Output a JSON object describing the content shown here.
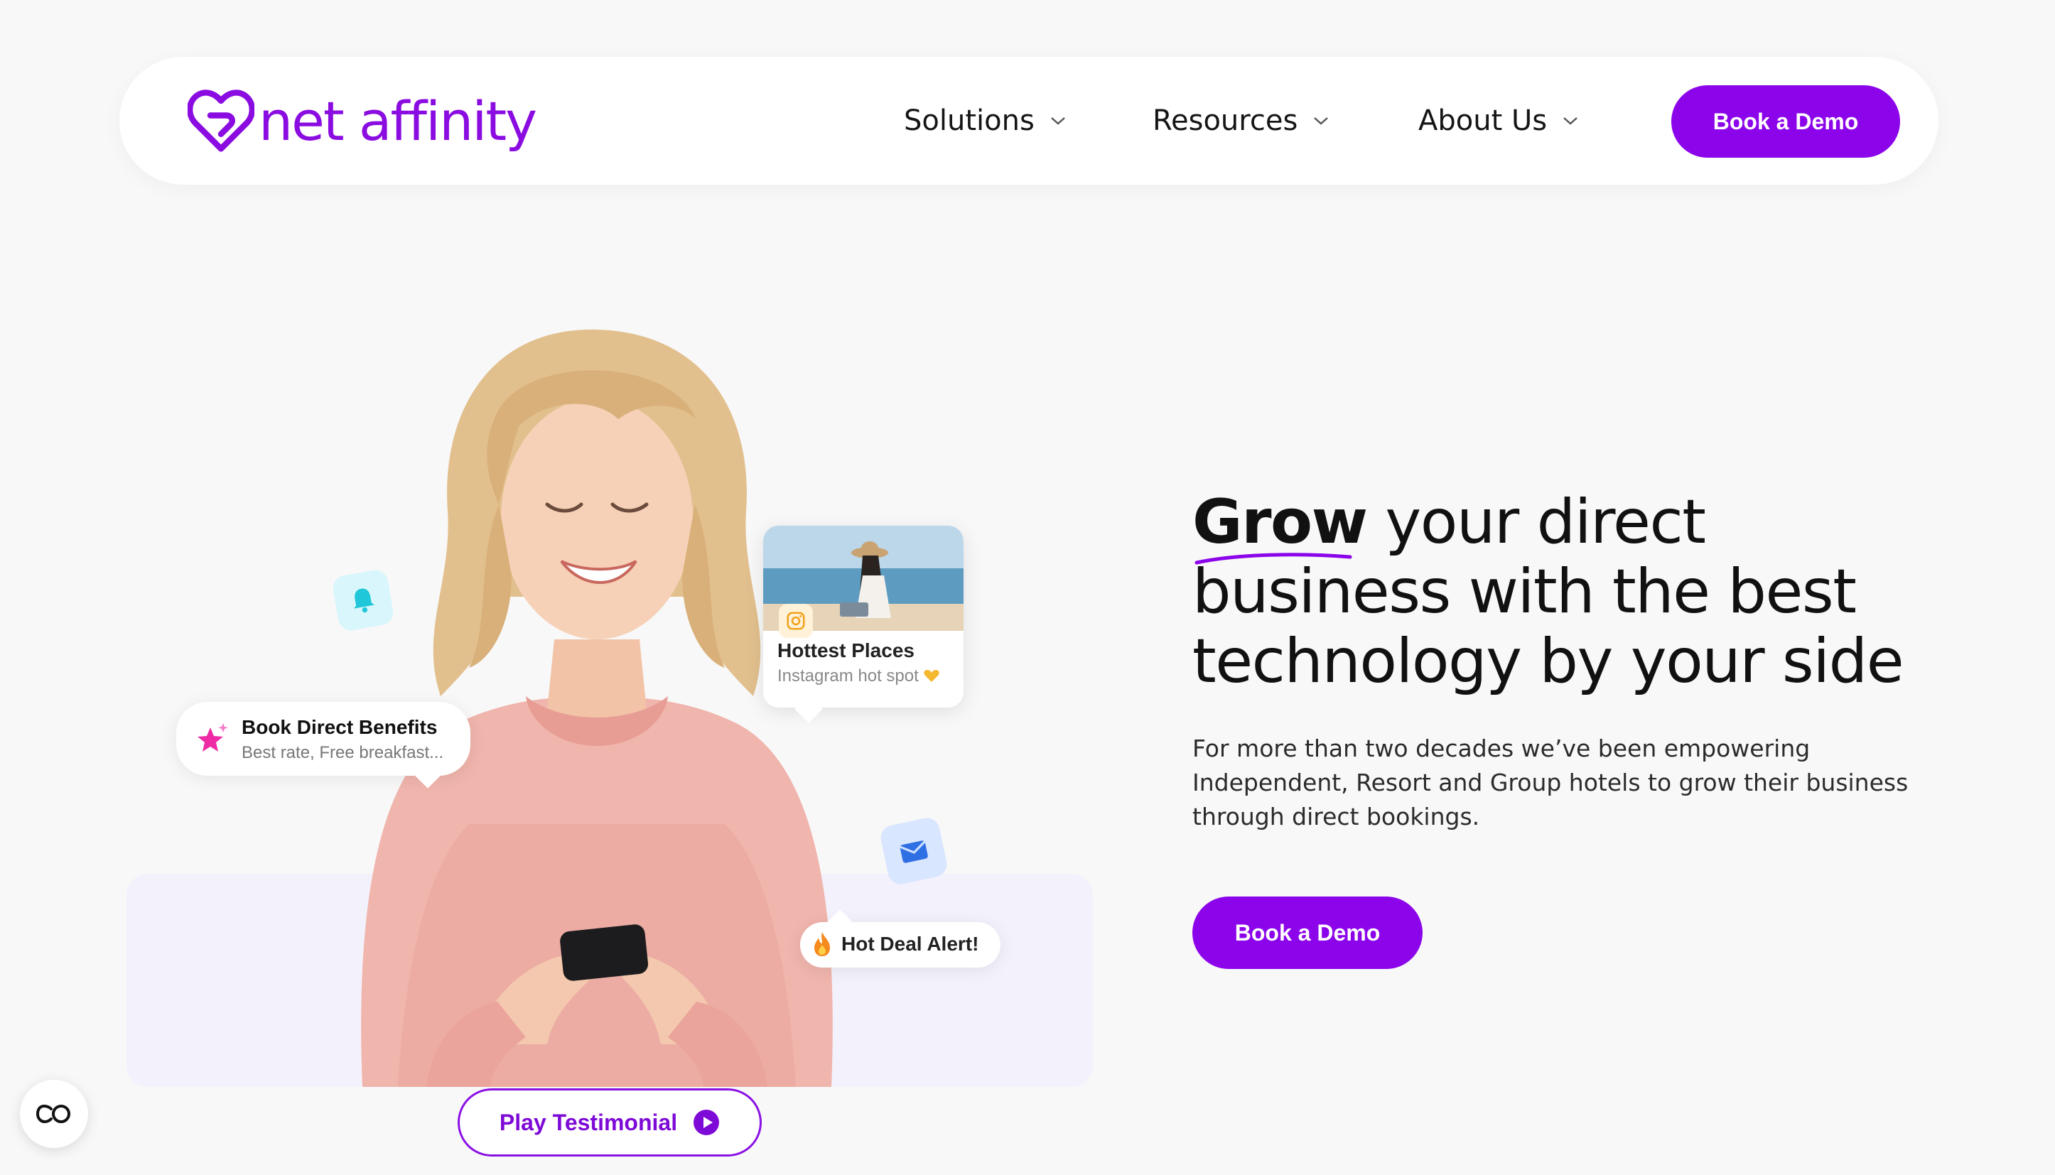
{
  "header": {
    "logo_text": "net affinity",
    "nav": [
      {
        "label": "Solutions"
      },
      {
        "label": "Resources"
      },
      {
        "label": "About Us"
      }
    ],
    "cta_label": "Book a Demo"
  },
  "hero": {
    "headline_bold": "Grow",
    "headline_line1_rest": "your direct",
    "headline_line2": "business with the best",
    "headline_line3": "technology by your side",
    "description": "For more than two decades we’ve been empowering Independent, Resort and Group hotels to grow their business through direct bookings.",
    "cta_label": "Book a Demo",
    "testimonial_label": "Play Testimonial"
  },
  "floating": {
    "book_direct": {
      "title": "Book Direct Benefits",
      "subtitle": "Best rate, Free breakfast..."
    },
    "hottest": {
      "title": "Hottest Places",
      "subtitle": "Instagram hot spot"
    },
    "hot_deal": {
      "title": "Hot Deal Alert!"
    }
  },
  "icons": {
    "logo": "heart-logo-icon",
    "nav_chevron": "chevron-down-icon",
    "bell": "bell-icon",
    "mail": "mail-icon",
    "star": "star-icon",
    "instagram": "instagram-icon",
    "heart_emoji": "heart-icon",
    "flame": "flame-icon",
    "play": "play-icon",
    "accessibility": "accessibility-icon"
  },
  "colors": {
    "brand": "#8c04ea",
    "background": "#f8f8f9",
    "text": "#111111"
  }
}
